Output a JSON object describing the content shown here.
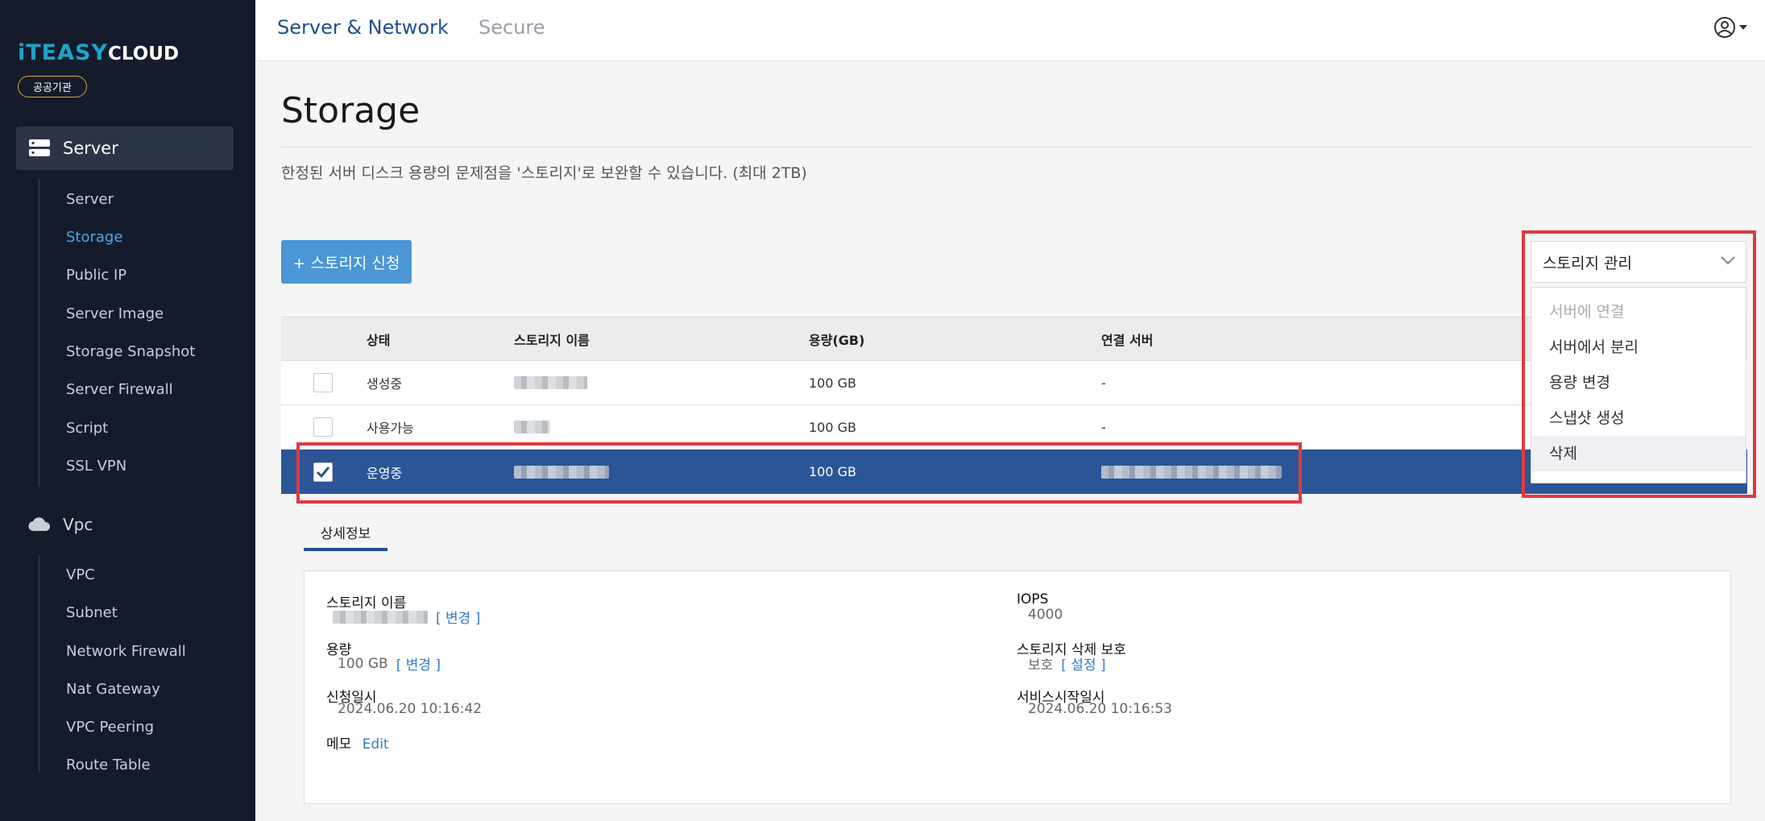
{
  "brand": {
    "logo_prefix": "iTEASY",
    "logo_suffix": "CLOUD",
    "badge": "공공기관"
  },
  "sidebar": {
    "groups": [
      {
        "label": "Server",
        "icon": "server-icon",
        "items": [
          "Server",
          "Storage",
          "Public IP",
          "Server Image",
          "Storage Snapshot",
          "Server Firewall",
          "Script",
          "SSL VPN"
        ],
        "active_item": "Storage"
      },
      {
        "label": "Vpc",
        "icon": "cloud-icon",
        "items": [
          "VPC",
          "Subnet",
          "Network Firewall",
          "Nat Gateway",
          "VPC Peering",
          "Route Table"
        ]
      }
    ]
  },
  "topbar": {
    "tabs": [
      "Server & Network",
      "Secure"
    ],
    "active_tab": "Server & Network",
    "user_icon": "user-circle-icon"
  },
  "page": {
    "title": "Storage",
    "description": "한정된 서버 디스크 용량의 문제점을 '스토리지'로 보완할 수 있습니다. (최대 2TB)",
    "apply_button": "+ 스토리지 신청"
  },
  "manage_dropdown": {
    "selected": "스토리지 관리",
    "options": [
      {
        "label": "서버에 연결",
        "disabled": true
      },
      {
        "label": "서버에서 분리",
        "disabled": false
      },
      {
        "label": "용량 변경",
        "disabled": false
      },
      {
        "label": "스냅샷 생성",
        "disabled": false
      },
      {
        "label": "삭제",
        "disabled": false,
        "hover": true
      }
    ]
  },
  "table": {
    "columns": [
      "상태",
      "스토리지 이름",
      "용량(GB)",
      "연결 서버"
    ],
    "rows": [
      {
        "checked": false,
        "status": "생성중",
        "name": "",
        "size": "100 GB",
        "server": "-"
      },
      {
        "checked": false,
        "status": "사용가능",
        "name": "",
        "size": "100 GB",
        "server": "-"
      },
      {
        "checked": true,
        "status": "운영중",
        "name": "",
        "size": "100 GB",
        "server": ""
      }
    ]
  },
  "detail": {
    "tab": "상세정보",
    "storage_name_label": "스토리지 이름",
    "change_link": "[ 변경 ]",
    "capacity_label": "용량",
    "capacity_value": "100 GB",
    "requested_label": "신청일시",
    "requested_value": "2024.06.20 10:16:42",
    "memo_label": "메모",
    "memo_link": "Edit",
    "iops_label": "IOPS",
    "iops_value": "4000",
    "protect_label": "스토리지 삭제 보호",
    "protect_value": "보호",
    "protect_link": "[ 설정 ]",
    "service_start_label": "서비스시작일시",
    "service_start_value": "2024.06.20 10:16:53"
  },
  "colors": {
    "sidebar_bg": "#141c2c",
    "accent_blue": "#4a96d6",
    "selected_row": "#2b5596",
    "highlight_red": "#e0393e"
  }
}
